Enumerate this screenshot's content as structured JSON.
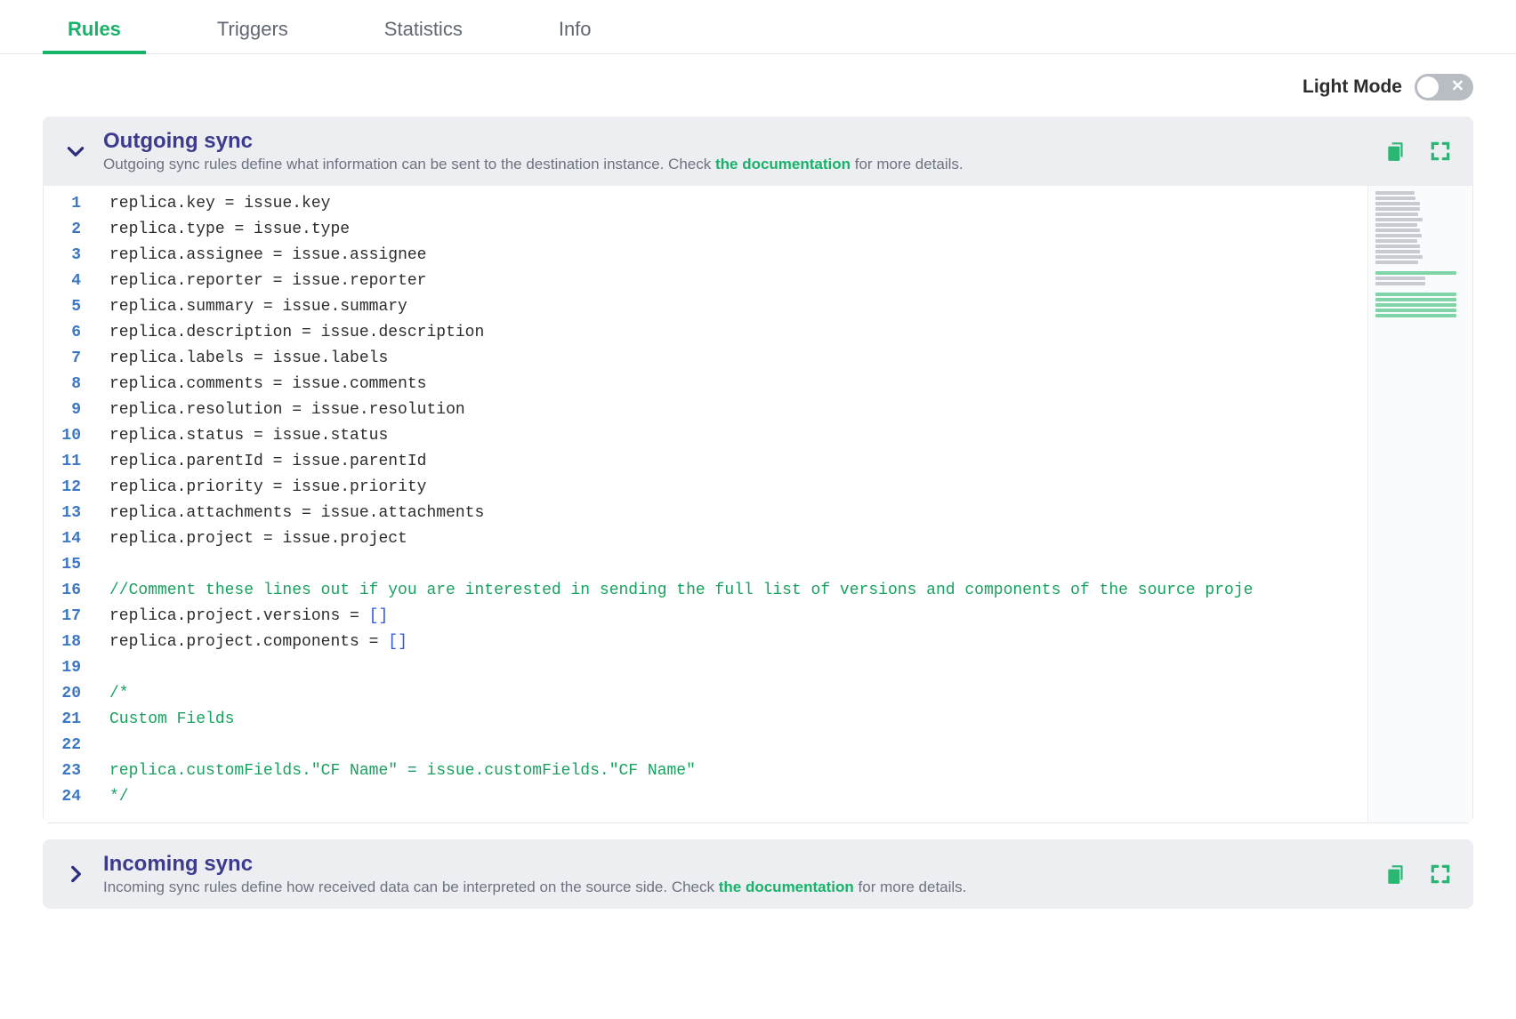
{
  "tabs": {
    "items": [
      {
        "label": "Rules",
        "active": true
      },
      {
        "label": "Triggers",
        "active": false
      },
      {
        "label": "Statistics",
        "active": false
      },
      {
        "label": "Info",
        "active": false
      }
    ]
  },
  "mode": {
    "label": "Light Mode"
  },
  "panels": {
    "outgoing": {
      "title": "Outgoing sync",
      "sub_pre": "Outgoing sync rules define what information can be sent to the destination instance. Check ",
      "sub_link": "the documentation",
      "sub_post": " for more details.",
      "expanded": true
    },
    "incoming": {
      "title": "Incoming sync",
      "sub_pre": "Incoming sync rules define how received data can be interpreted on the source side. Check ",
      "sub_link": "the documentation",
      "sub_post": " for more details.",
      "expanded": false
    }
  },
  "editor": {
    "lines": [
      {
        "n": 1,
        "kind": "assign",
        "lhs": "replica.key",
        "rhs": "issue.key"
      },
      {
        "n": 2,
        "kind": "assign",
        "lhs": "replica.type",
        "rhs": "issue.type"
      },
      {
        "n": 3,
        "kind": "assign",
        "lhs": "replica.assignee",
        "rhs": "issue.assignee"
      },
      {
        "n": 4,
        "kind": "assign",
        "lhs": "replica.reporter",
        "rhs": "issue.reporter"
      },
      {
        "n": 5,
        "kind": "assign",
        "lhs": "replica.summary",
        "rhs": "issue.summary"
      },
      {
        "n": 6,
        "kind": "assign",
        "lhs": "replica.description",
        "rhs": "issue.description"
      },
      {
        "n": 7,
        "kind": "assign",
        "lhs": "replica.labels",
        "rhs": "issue.labels"
      },
      {
        "n": 8,
        "kind": "assign",
        "lhs": "replica.comments",
        "rhs": "issue.comments"
      },
      {
        "n": 9,
        "kind": "assign",
        "lhs": "replica.resolution",
        "rhs": "issue.resolution"
      },
      {
        "n": 10,
        "kind": "assign",
        "lhs": "replica.status",
        "rhs": "issue.status"
      },
      {
        "n": 11,
        "kind": "assign",
        "lhs": "replica.parentId",
        "rhs": "issue.parentId"
      },
      {
        "n": 12,
        "kind": "assign",
        "lhs": "replica.priority",
        "rhs": "issue.priority"
      },
      {
        "n": 13,
        "kind": "assign",
        "lhs": "replica.attachments",
        "rhs": "issue.attachments"
      },
      {
        "n": 14,
        "kind": "assign",
        "lhs": "replica.project",
        "rhs": "issue.project"
      },
      {
        "n": 15,
        "kind": "blank"
      },
      {
        "n": 16,
        "kind": "comment",
        "text": "//Comment these lines out if you are interested in sending the full list of versions and components of the source proje"
      },
      {
        "n": 17,
        "kind": "assign_arr",
        "lhs": "replica.project.versions"
      },
      {
        "n": 18,
        "kind": "assign_arr",
        "lhs": "replica.project.components"
      },
      {
        "n": 19,
        "kind": "blank"
      },
      {
        "n": 20,
        "kind": "comment",
        "text": "/*"
      },
      {
        "n": 21,
        "kind": "comment",
        "text": "Custom Fields"
      },
      {
        "n": 22,
        "kind": "comment",
        "text": ""
      },
      {
        "n": 23,
        "kind": "comment",
        "text": "replica.customFields.\"CF Name\" = issue.customFields.\"CF Name\""
      },
      {
        "n": 24,
        "kind": "comment",
        "text": "*/"
      }
    ],
    "lhs_col_width": 22
  }
}
